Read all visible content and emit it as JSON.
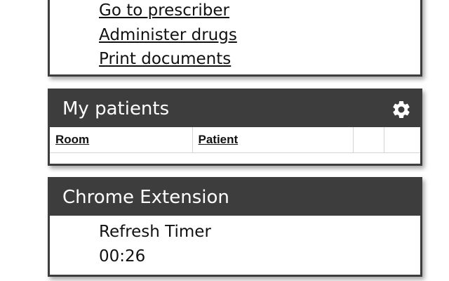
{
  "quick_links": {
    "items": [
      {
        "label": "Go to prescriber"
      },
      {
        "label": "Administer drugs"
      },
      {
        "label": "Print documents"
      }
    ]
  },
  "my_patients": {
    "title": "My patients",
    "settings_icon": "gear-icon",
    "columns": [
      "Room",
      "Patient",
      "",
      ""
    ]
  },
  "chrome_extension": {
    "title": "Chrome Extension",
    "timer_label": "Refresh Timer",
    "timer_value": "00:26"
  },
  "colors": {
    "header_bg": "#3d3d3d",
    "header_text": "#ffffff"
  }
}
